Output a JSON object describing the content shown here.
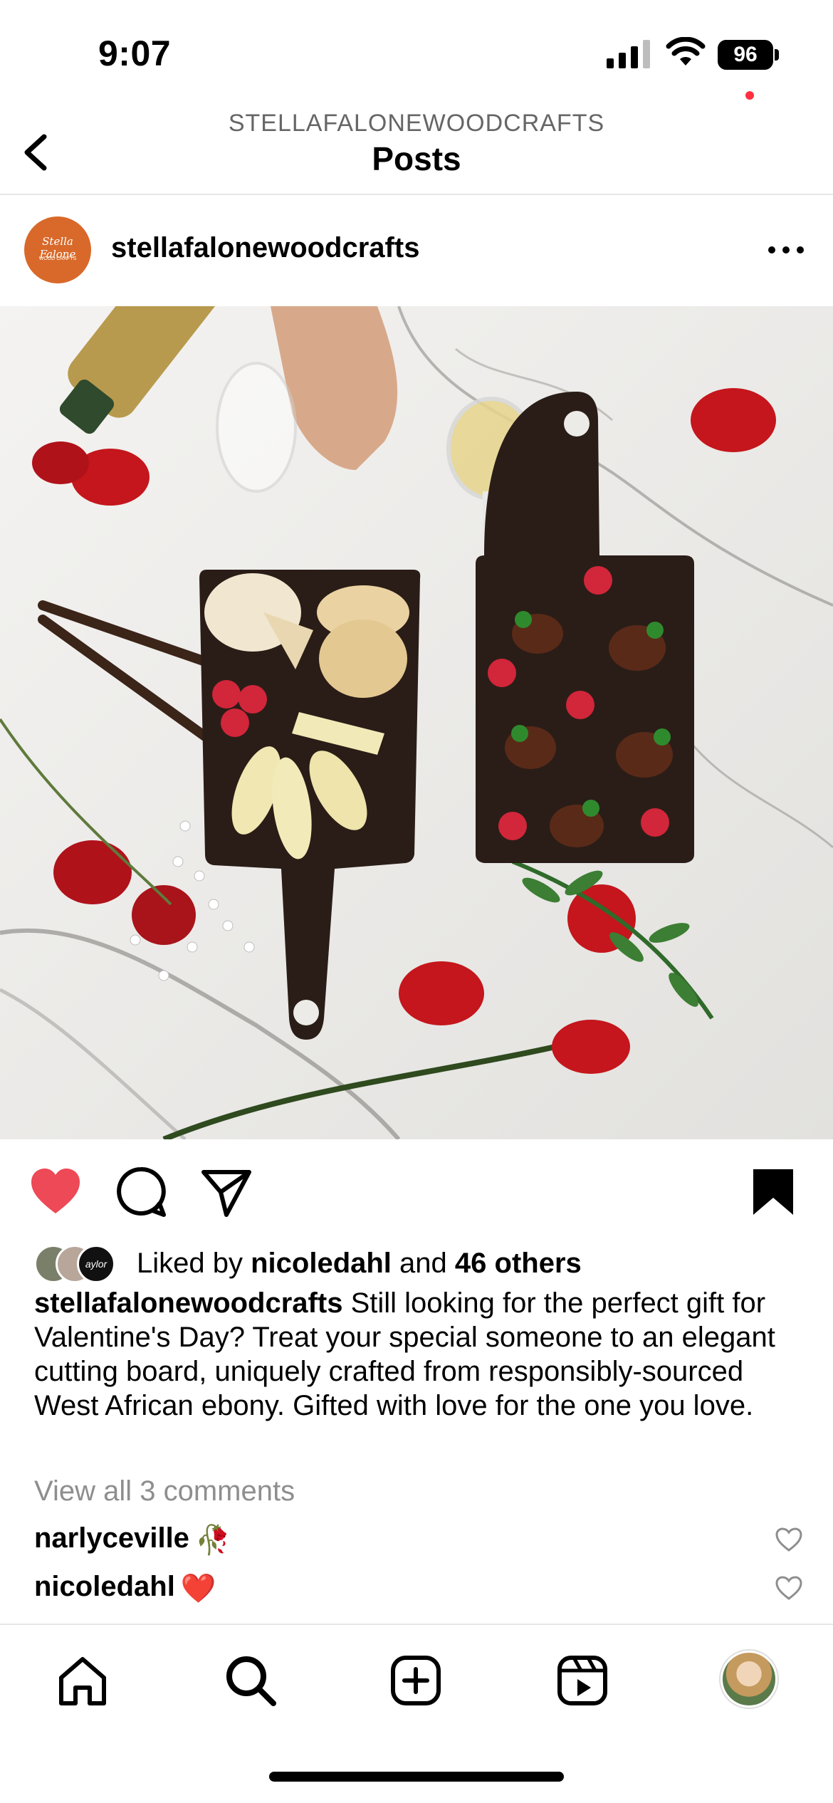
{
  "status_bar": {
    "time": "9:07",
    "battery": "96"
  },
  "header": {
    "subtitle": "STELLAFALONEWOODCRAFTS",
    "title": "Posts"
  },
  "post": {
    "username": "stellafalonewoodcrafts",
    "avatar_text": "Stella Falone",
    "avatar_subtext": "WOOD CRAFTS",
    "liked_by_prefix": "Liked by",
    "liked_by_user": "nicoledahl",
    "liked_by_and": "and",
    "liked_by_others": "46 others",
    "mini_avatar_label": "aylor",
    "caption_user": "stellafalonewoodcrafts",
    "caption_text": "Still looking for the perfect gift for Valentine's Day? Treat your special someone to an elegant cutting board, uniquely crafted from responsibly-sourced West African ebony. Gifted with love for the one you love.",
    "view_comments": "View all 3 comments",
    "comments": [
      {
        "user": "narlyceville",
        "emoji": "🥀"
      },
      {
        "user": "nicoledahl",
        "emoji": "❤️"
      }
    ],
    "liked": true,
    "saved": true
  },
  "colors": {
    "like": "#ed4956",
    "avatar": "#d8692a",
    "notif": "#ff3040",
    "muted": "#8e8e8e"
  },
  "icons": [
    "back-chevron-icon",
    "more-icon",
    "heart-icon",
    "comment-icon",
    "share-icon",
    "bookmark-icon",
    "home-icon",
    "search-icon",
    "add-icon",
    "reels-icon"
  ]
}
